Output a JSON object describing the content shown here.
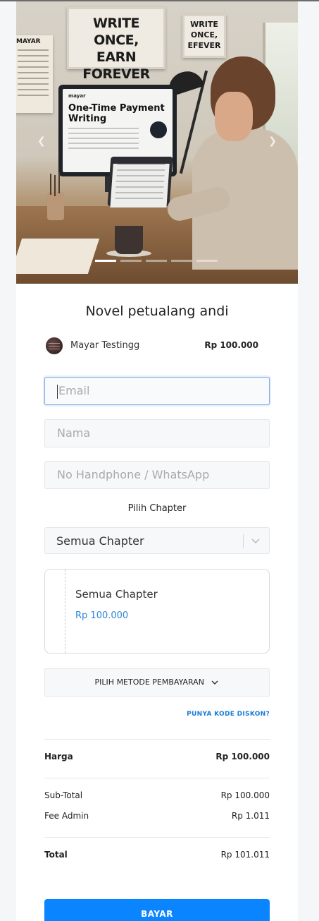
{
  "hero": {
    "poster_main": [
      "WRITE ONCE,",
      "EARN FOREVER"
    ],
    "poster_side": [
      "WRITE",
      "ONCE,",
      "EFEVER"
    ],
    "poster_note": "MAYAR",
    "screen_brand": "mayar",
    "screen_headline": [
      "One-Time Payment",
      "Writing"
    ],
    "slides_total": 5,
    "active_slide": 1
  },
  "product": {
    "title": "Novel petualang andi",
    "seller": "Mayar Testingg",
    "price": "Rp 100.000"
  },
  "form": {
    "email_placeholder": "Email",
    "name_placeholder": "Nama",
    "phone_placeholder": "No Handphone / WhatsApp",
    "chapter_label": "Pilih Chapter",
    "chapter_selected": "Semua Chapter"
  },
  "chapter_card": {
    "name": "Semua Chapter",
    "price": "Rp 100.000"
  },
  "payment": {
    "method_label": "PILIH METODE PEMBAYARAN",
    "promo_link": "PUNYA KODE DISKON?"
  },
  "summary": {
    "harga_label": "Harga",
    "harga_value": "Rp 100.000",
    "subtotal_label": "Sub-Total",
    "subtotal_value": "Rp 100.000",
    "fee_label": "Fee Admin",
    "fee_value": "Rp 1.011",
    "total_label": "Total",
    "total_value": "Rp 101.011"
  },
  "action": {
    "pay_label": "BAYAR"
  },
  "colors": {
    "accent": "#0a84ff",
    "link": "#1a7bd6",
    "price_blue": "#2f86d6"
  }
}
